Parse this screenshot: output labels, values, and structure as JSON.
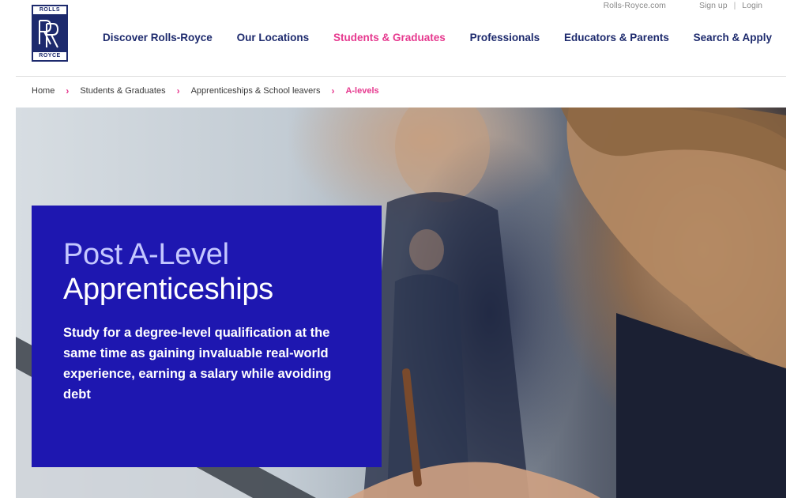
{
  "utility": {
    "site_link": "Rolls-Royce.com",
    "signup": "Sign up",
    "separator": "|",
    "login": "Login"
  },
  "logo": {
    "top_text": "ROLLS",
    "bottom_text": "ROYCE"
  },
  "nav": {
    "items": [
      {
        "label": "Discover Rolls-Royce"
      },
      {
        "label": "Our Locations"
      },
      {
        "label": "Students & Graduates"
      },
      {
        "label": "Professionals"
      },
      {
        "label": "Educators & Parents"
      },
      {
        "label": "Search & Apply"
      }
    ],
    "active_index": 2
  },
  "breadcrumb": {
    "items": [
      "Home",
      "Students & Graduates",
      "Apprenticeships & School leavers",
      "A-levels"
    ]
  },
  "hero": {
    "title_line1": "Post A-Level",
    "title_line2": "Apprenticeships",
    "description": "Study for a degree-level qualification at the same time as gaining invaluable real-world experience, earning a salary while avoiding debt"
  },
  "colors": {
    "brand_navy": "#1d2a6d",
    "accent_pink": "#e6388e",
    "panel_blue": "#1e17b0",
    "title_light": "#c4c7ff"
  },
  "icons": [
    "rr-monogram-icon",
    "chevron-right-icon"
  ]
}
